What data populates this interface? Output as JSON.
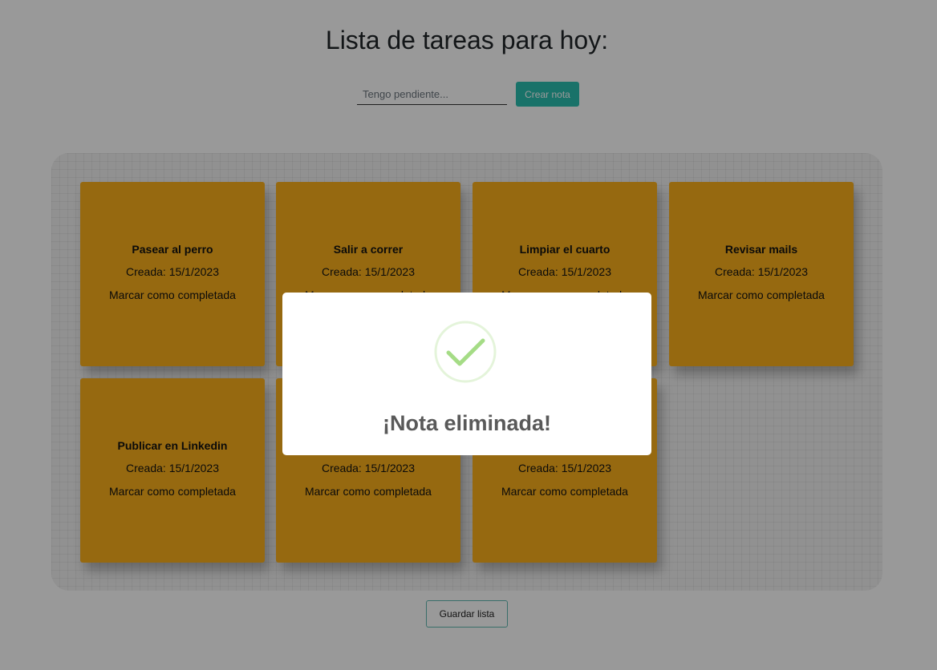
{
  "header": {
    "title": "Lista de tareas para hoy:"
  },
  "form": {
    "input_placeholder": "Tengo pendiente...",
    "input_value": "",
    "create_label": "Crear nota"
  },
  "notes": [
    {
      "title": "Pasear al perro",
      "date": "Creada: 15/1/2023",
      "action": "Marcar como completada"
    },
    {
      "title": "Salir a correr",
      "date": "Creada: 15/1/2023",
      "action": "Marcar como completada"
    },
    {
      "title": "Limpiar el cuarto",
      "date": "Creada: 15/1/2023",
      "action": "Marcar como completada"
    },
    {
      "title": "Revisar mails",
      "date": "Creada: 15/1/2023",
      "action": "Marcar como completada"
    },
    {
      "title": "Publicar en Linkedin",
      "date": "Creada: 15/1/2023",
      "action": "Marcar como completada"
    },
    {
      "title": "",
      "date": "Creada: 15/1/2023",
      "action": "Marcar como completada"
    },
    {
      "title": "",
      "date": "Creada: 15/1/2023",
      "action": "Marcar como completada"
    }
  ],
  "footer": {
    "save_label": "Guardar lista"
  },
  "modal": {
    "title": "¡Nota eliminada!",
    "icon": "success-check-icon"
  },
  "colors": {
    "note": "#fbaf1c",
    "accent": "#2abfb0",
    "success": "#a5dc86",
    "overlay": "rgba(0,0,0,0.4)"
  }
}
